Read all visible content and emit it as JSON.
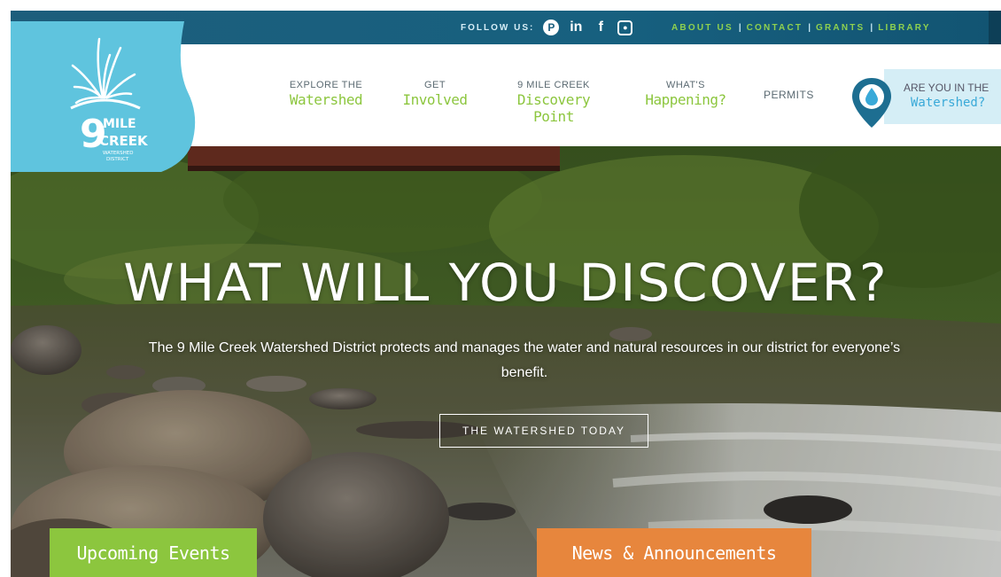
{
  "topbar": {
    "follow_label": "FOLLOW US:",
    "social_icons": [
      "pinterest-icon",
      "linkedin-icon",
      "facebook-icon",
      "instagram-icon"
    ],
    "links": [
      "ABOUT US",
      "CONTACT",
      "GRANTS",
      "LIBRARY"
    ]
  },
  "logo": {
    "number": "9",
    "line1": "MILE",
    "line2": "CREEK",
    "line3": "WATERSHED",
    "line4": "DISTRICT"
  },
  "nav": {
    "items": [
      {
        "small": "EXPLORE THE",
        "big": "Watershed"
      },
      {
        "small": "GET",
        "big": "Involved"
      },
      {
        "small": "9 MILE CREEK",
        "big": "Discovery Point"
      },
      {
        "small": "WHAT'S",
        "big": "Happening?"
      }
    ],
    "permits": "PERMITS",
    "watershed_small": "ARE YOU IN THE",
    "watershed_big": "Watershed?"
  },
  "hero": {
    "title": "WHAT WILL YOU DISCOVER?",
    "subtitle": "The 9 Mile Creek Watershed District protects and manages the water and natural resources in our district for everyone’s benefit.",
    "button": "THE WATERSHED TODAY"
  },
  "tabs": {
    "events": "Upcoming Events",
    "news": "News & Announcements"
  },
  "colors": {
    "green": "#8cc63e",
    "blue": "#39a9d8",
    "orange": "#e7863d",
    "dark_blue": "#1b5f7e",
    "logo_bg": "#5fc4de"
  }
}
